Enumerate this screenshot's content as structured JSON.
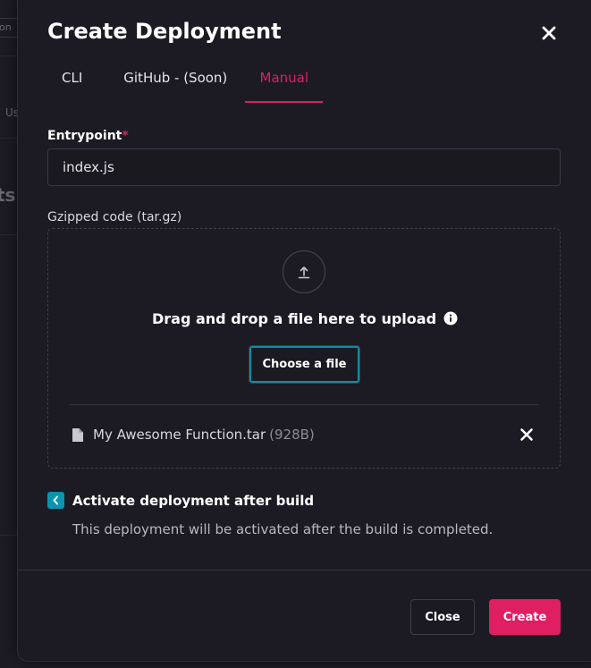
{
  "background": {
    "pill_text": "on",
    "side_text": "Us",
    "heading_fragment": "ts"
  },
  "modal": {
    "title": "Create Deployment",
    "tabs": [
      {
        "label": "CLI",
        "active": false
      },
      {
        "label": "GitHub - (Soon)",
        "active": false
      },
      {
        "label": "Manual",
        "active": true
      }
    ],
    "entrypoint": {
      "label": "Entrypoint",
      "required_mark": "*",
      "value": "index.js"
    },
    "code": {
      "label": "Gzipped code (tar.gz)",
      "drop_title": "Drag and drop a file here to upload",
      "choose_label": "Choose a file",
      "file_name": "My Awesome Function.tar",
      "file_size": "(928B)"
    },
    "activate": {
      "checked": true,
      "label": "Activate deployment after build",
      "description": "This deployment will be activated after the build is completed."
    },
    "footer": {
      "close_label": "Close",
      "create_label": "Create"
    }
  },
  "colors": {
    "accent": "#e01e62",
    "checkbox": "#0a94ad",
    "focus_ring": "#0b8ea6",
    "modal_bg": "#1c1b23"
  },
  "icons": {
    "close": "close-icon",
    "upload": "upload-icon",
    "info": "info-icon",
    "file": "file-icon",
    "remove": "remove-file-icon",
    "check": "check-icon"
  }
}
